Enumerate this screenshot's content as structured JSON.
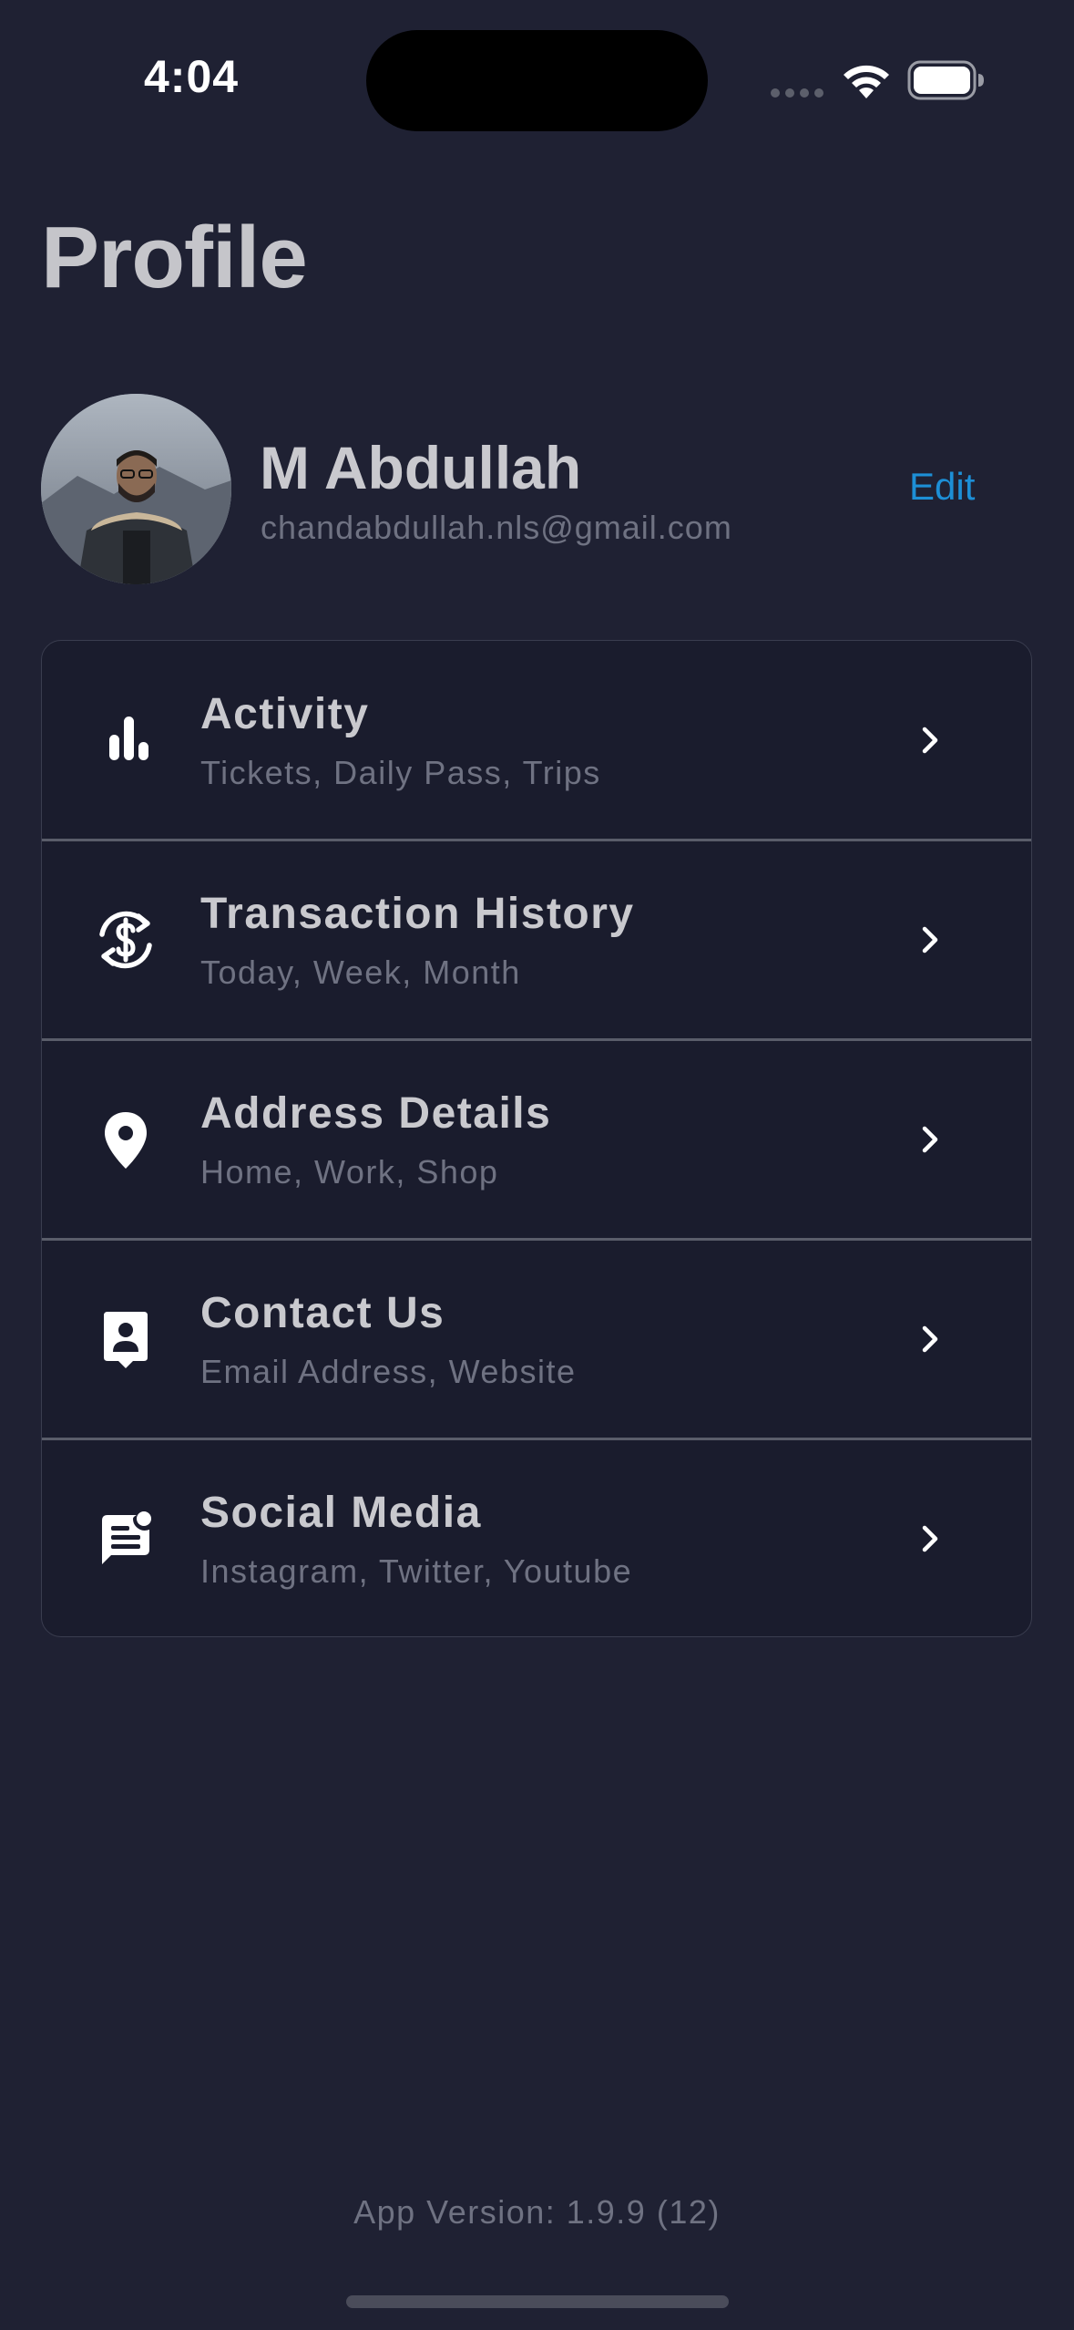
{
  "status_bar": {
    "time": "4:04"
  },
  "page": {
    "title": "Profile"
  },
  "profile": {
    "name": "M Abdullah",
    "email": "chandabdullah.nls@gmail.com",
    "edit_label": "Edit"
  },
  "menu": {
    "items": [
      {
        "title": "Activity",
        "subtitle": "Tickets, Daily Pass, Trips",
        "icon": "bar-chart-icon"
      },
      {
        "title": "Transaction History",
        "subtitle": "Today, Week, Month",
        "icon": "currency-exchange-icon"
      },
      {
        "title": "Address Details",
        "subtitle": "Home, Work, Shop",
        "icon": "location-pin-icon"
      },
      {
        "title": "Contact Us",
        "subtitle": "Email Address, Website",
        "icon": "contact-card-icon"
      },
      {
        "title": "Social Media",
        "subtitle": "Instagram, Twitter, Youtube",
        "icon": "chat-notification-icon"
      }
    ]
  },
  "footer": {
    "app_version": "App Version: 1.9.9 (12)"
  },
  "colors": {
    "background": "#1f2133",
    "card": "#1a1c2d",
    "accent": "#1d8fd6",
    "text_primary": "#c9c9ce",
    "text_secondary": "#6f7282"
  }
}
